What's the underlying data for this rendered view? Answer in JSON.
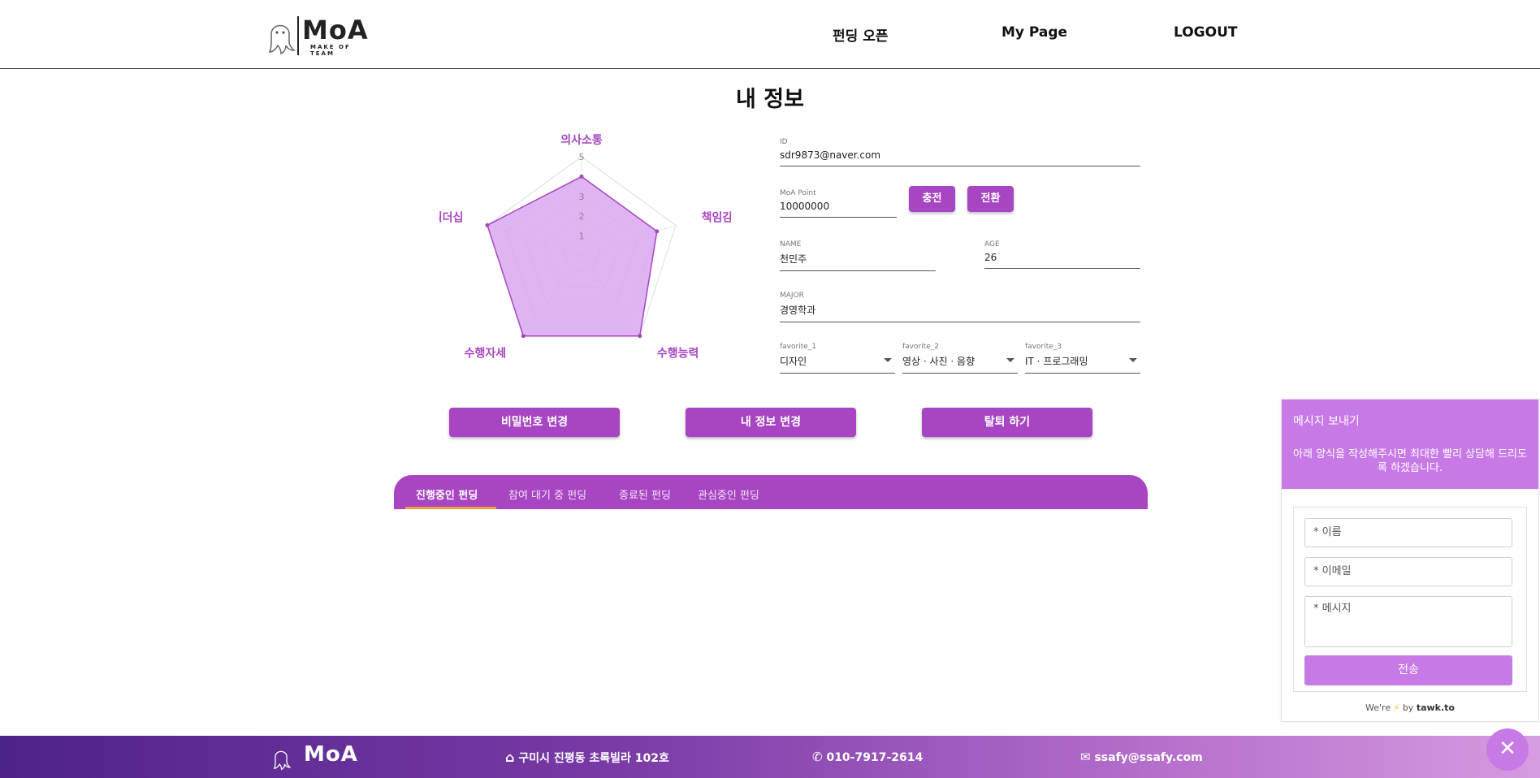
{
  "header": {
    "logo_text": "MoA",
    "logo_sub": "MAKE OF TEAM",
    "nav": [
      "펀딩 오픈",
      "My Page",
      "LOGOUT"
    ]
  },
  "page_title": "내 정보",
  "radar": {
    "labels": [
      "의사소통",
      "책임감",
      "수행능력",
      "수행자세",
      "리더십"
    ],
    "tick_labels": [
      "1",
      "2",
      "3",
      "5"
    ],
    "values": [
      4,
      4,
      5,
      5,
      5
    ],
    "max": 5,
    "fill_color": "#d9a7f0",
    "stroke_color": "#a845c2"
  },
  "profile": {
    "id_label": "ID",
    "id_value": "sdr9873@naver.com",
    "point_label": "MoA Point",
    "point_value": "10000000",
    "charge_label": "충전",
    "convert_label": "전환",
    "name_label": "NAME",
    "name_value": "천민주",
    "age_label": "AGE",
    "age_value": "26",
    "major_label": "MAJOR",
    "major_value": "경영학과",
    "fav1_label": "favorite_1",
    "fav1_value": "디자인",
    "fav2_label": "favorite_2",
    "fav2_value": "영상 · 사진 · 음향",
    "fav3_label": "favorite_3",
    "fav3_value": "IT · 프로그래밍"
  },
  "actions": [
    "비밀번호 변경",
    "내 정보 변경",
    "탈퇴 하기"
  ],
  "tabs": [
    "진행중인 펀딩",
    "참여 대기 중 펀딩",
    "종료된 펀딩",
    "관심중인 펀딩"
  ],
  "chat": {
    "title": "메시지 보내기",
    "description": "아래 양식을 작성해주시면 최대한 빨리 상담해 드리도록 하겠습니다.",
    "name_placeholder": "* 이름",
    "email_placeholder": "* 이메일",
    "message_placeholder": "* 메시지",
    "send_label": "전송",
    "footer_pre": "We're",
    "footer_mid": "by",
    "footer_brand": "tawk.to"
  },
  "footer": {
    "address": "구미시 진평동 초록빌라 102호",
    "phone": "010-7917-2614",
    "email": "ssafy@ssafy.com"
  },
  "colors": {
    "primary": "#a845c2",
    "chat_accent": "#c77ae6",
    "tab_underline": "#f0a33b"
  }
}
